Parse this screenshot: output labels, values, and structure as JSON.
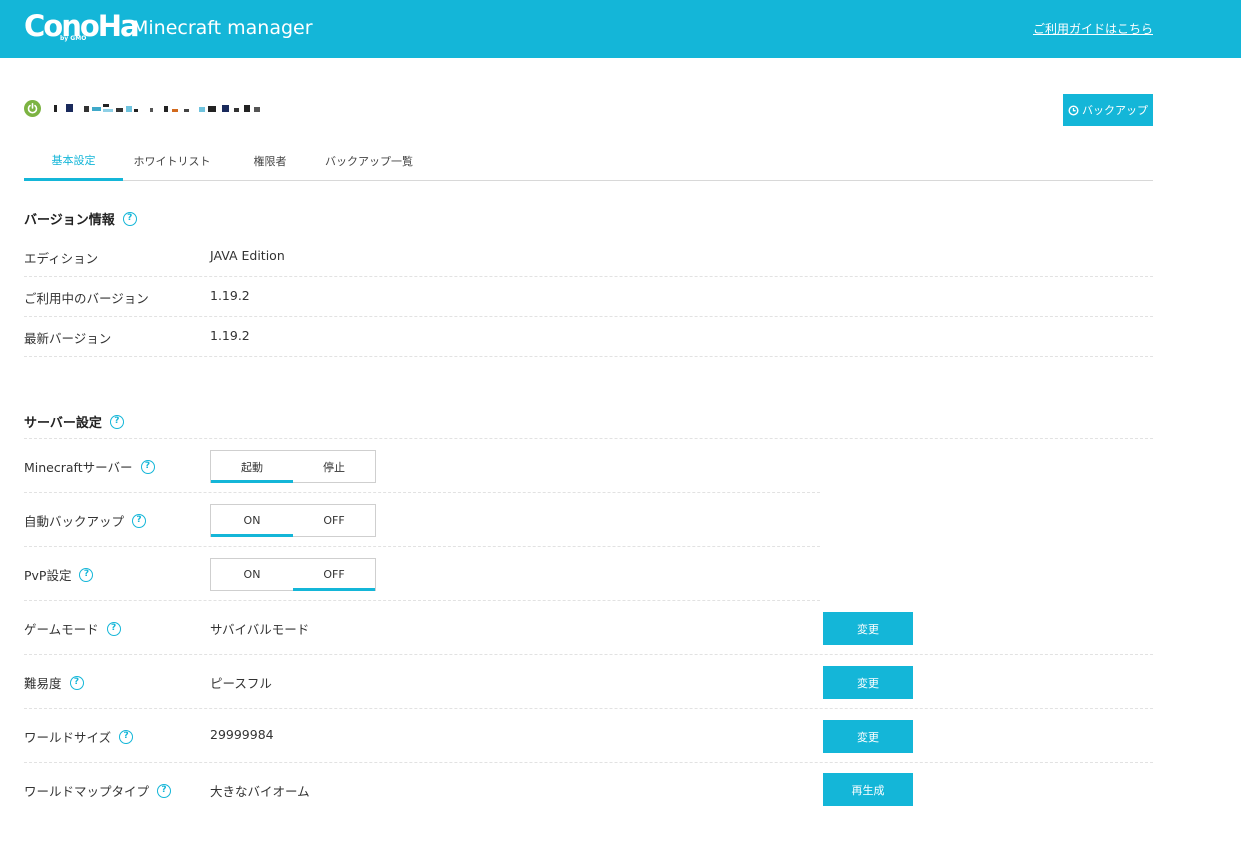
{
  "header": {
    "logo": "ConoHa",
    "logo_sub": "by GMO",
    "app_title": "Minecraft manager",
    "guide_link": "ご利用ガイドはこちら"
  },
  "server": {
    "status_icon": "power-icon",
    "status_color": "#7cb342",
    "backup_button": "バックアップ"
  },
  "tabs": [
    {
      "label": "基本設定",
      "active": true
    },
    {
      "label": "ホワイトリスト",
      "active": false
    },
    {
      "label": "権限者",
      "active": false
    },
    {
      "label": "バックアップ一覧",
      "active": false
    }
  ],
  "version_section": {
    "title": "バージョン情報",
    "help": "?",
    "rows": [
      {
        "label": "エディション",
        "value": "JAVA Edition"
      },
      {
        "label": "ご利用中のバージョン",
        "value": "1.19.2"
      },
      {
        "label": "最新バージョン",
        "value": "1.19.2"
      }
    ]
  },
  "server_section": {
    "title": "サーバー設定",
    "help": "?",
    "toggles": [
      {
        "label": "Minecraftサーバー",
        "on_label": "起動",
        "off_label": "停止",
        "selected": "on"
      },
      {
        "label": "自動バックアップ",
        "on_label": "ON",
        "off_label": "OFF",
        "selected": "on"
      },
      {
        "label": "PvP設定",
        "on_label": "ON",
        "off_label": "OFF",
        "selected": "off"
      }
    ],
    "settings": [
      {
        "label": "ゲームモード",
        "value": "サバイバルモード",
        "button": "変更"
      },
      {
        "label": "難易度",
        "value": "ピースフル",
        "button": "変更"
      },
      {
        "label": "ワールドサイズ",
        "value": "29999984",
        "button": "変更"
      },
      {
        "label": "ワールドマップタイプ",
        "value": "大きなバイオーム",
        "button": "再生成"
      }
    ]
  },
  "colors": {
    "accent": "#14b6d8",
    "status_green": "#7cb342"
  }
}
